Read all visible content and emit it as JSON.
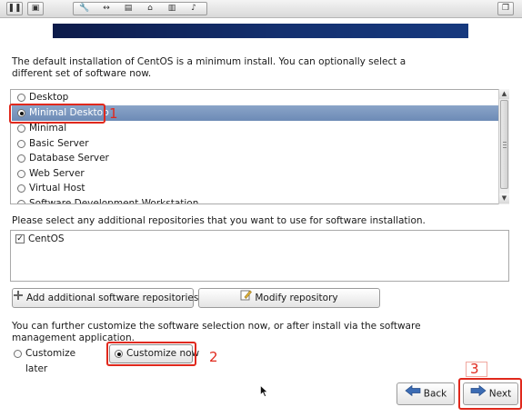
{
  "banner": {
    "brand_color": "#14306f"
  },
  "intro_text_line1": "The default installation of CentOS is a minimum install. You can optionally select a",
  "intro_text_line2": "different set of software now.",
  "software_sets": [
    {
      "label": "Desktop",
      "selected": false
    },
    {
      "label": "Minimal Desktop",
      "selected": true
    },
    {
      "label": "Minimal",
      "selected": false
    },
    {
      "label": "Basic Server",
      "selected": false
    },
    {
      "label": "Database Server",
      "selected": false
    },
    {
      "label": "Web Server",
      "selected": false
    },
    {
      "label": "Virtual Host",
      "selected": false
    },
    {
      "label": "Software Development Workstation",
      "selected": false
    }
  ],
  "repo_prompt": "Please select any additional repositories that you want to use for software installation.",
  "repositories": [
    {
      "label": "CentOS",
      "checked": true
    }
  ],
  "buttons": {
    "add_repo": "Add additional software repositories",
    "modify_repo": "Modify repository",
    "back": "Back",
    "next": "Next"
  },
  "customize_text_line1": "You can further customize the software selection now, or after install via the software",
  "customize_text_line2": "management application.",
  "customize_options": {
    "later": {
      "label": "Customize later",
      "selected": false
    },
    "now": {
      "label": "Customize now",
      "selected": true
    }
  },
  "annotations": {
    "step1": "1",
    "step2": "2",
    "step3": "3",
    "color": "#e0281c"
  },
  "icons": {
    "pause": "pause-icon",
    "disk": "disk-icon",
    "wrench": "wrench-icon",
    "arrows": "resize-arrows-icon",
    "usb": "usb-icon",
    "camera": "snapshot-icon",
    "trash": "trash-icon",
    "audio": "audio-icon",
    "window": "window-restore-icon",
    "add": "plus-icon",
    "edit": "edit-icon",
    "back": "arrow-left-icon",
    "next": "arrow-right-icon"
  }
}
